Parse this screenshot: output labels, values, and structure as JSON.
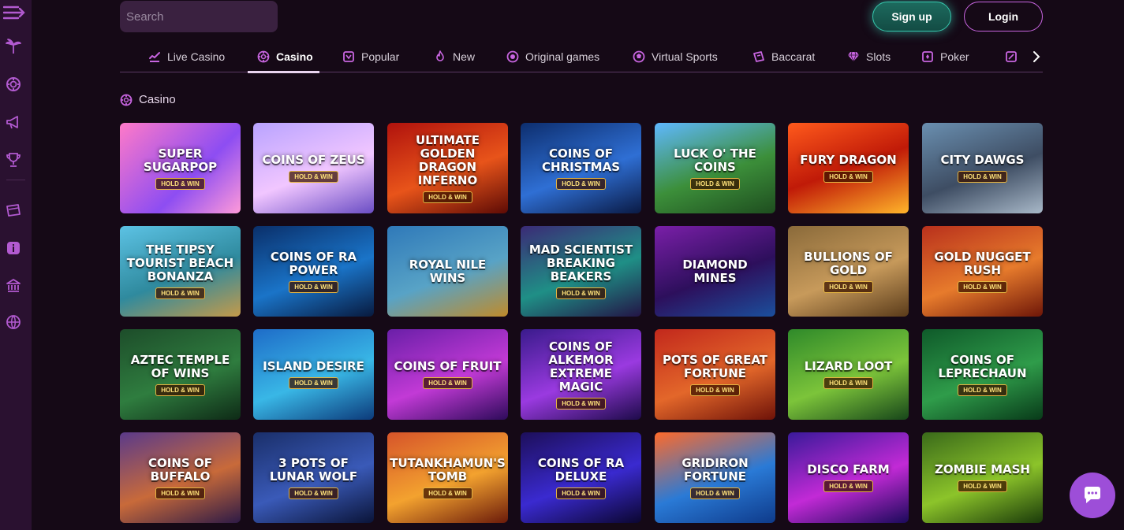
{
  "search": {
    "placeholder": "Search",
    "value": ""
  },
  "header": {
    "signup_label": "Sign up",
    "login_label": "Login"
  },
  "sidebar": {
    "icons": [
      "menu-toggle-icon",
      "palm-tree-icon",
      "casino-chip-icon",
      "megaphone-icon",
      "trophy-icon",
      "ticket-icon",
      "info-icon",
      "bank-icon",
      "globe-icon"
    ]
  },
  "tabs": [
    {
      "label": "Live Casino",
      "icon": "live-casino-icon",
      "active": false
    },
    {
      "label": "Casino",
      "icon": "casino-chip-icon",
      "active": true
    },
    {
      "label": "Popular",
      "icon": "popular-icon",
      "active": false
    },
    {
      "label": "New",
      "icon": "flame-icon",
      "active": false
    },
    {
      "label": "Original games",
      "icon": "original-games-icon",
      "active": false
    },
    {
      "label": "Virtual Sports",
      "icon": "virtual-sports-icon",
      "active": false
    },
    {
      "label": "Baccarat",
      "icon": "baccarat-icon",
      "active": false
    },
    {
      "label": "Slots",
      "icon": "diamond-icon",
      "active": false
    },
    {
      "label": "Poker",
      "icon": "poker-icon",
      "active": false
    }
  ],
  "section": {
    "title": "Casino"
  },
  "colors": {
    "accent": "#c865e0",
    "signup": "#36c8ad",
    "sidebar": "#2a1130",
    "background": "#150916",
    "chat": "#9d4ed8"
  },
  "games": [
    {
      "name": "Super SugarPop",
      "badge": "HOLD & WIN"
    },
    {
      "name": "Coins of Zeus",
      "badge": "HOLD & WIN"
    },
    {
      "name": "Ultimate Golden Dragon Inferno",
      "badge": "HOLD & WIN"
    },
    {
      "name": "Coins of Christmas",
      "badge": "HOLD & WIN"
    },
    {
      "name": "Luck o' the Coins",
      "badge": "HOLD & WIN"
    },
    {
      "name": "Fury Dragon",
      "badge": "HOLD & WIN"
    },
    {
      "name": "City Dawgs",
      "badge": "HOLD & WIN"
    },
    {
      "name": "The Tipsy Tourist Beach Bonanza",
      "badge": "HOLD & WIN"
    },
    {
      "name": "Coins of Ra Power",
      "badge": "HOLD & WIN"
    },
    {
      "name": "Royal Nile Wins",
      "badge": ""
    },
    {
      "name": "Mad Scientist Breaking Beakers",
      "badge": "HOLD & WIN"
    },
    {
      "name": "Diamond Mines",
      "badge": ""
    },
    {
      "name": "Bullions of Gold",
      "badge": "HOLD & WIN"
    },
    {
      "name": "Gold Nugget Rush",
      "badge": "HOLD & WIN"
    },
    {
      "name": "Aztec Temple of Wins",
      "badge": "HOLD & WIN"
    },
    {
      "name": "Island Desire",
      "badge": "HOLD & WIN"
    },
    {
      "name": "Coins of Fruit",
      "badge": "HOLD & WIN"
    },
    {
      "name": "Coins of Alkemor Extreme Magic",
      "badge": "HOLD & WIN"
    },
    {
      "name": "Pots of Great Fortune",
      "badge": "HOLD & WIN"
    },
    {
      "name": "Lizard Loot",
      "badge": "HOLD & WIN"
    },
    {
      "name": "Coins of Leprechaun",
      "badge": "HOLD & WIN"
    },
    {
      "name": "Coins of Buffalo",
      "badge": "HOLD & WIN"
    },
    {
      "name": "3 Pots of Lunar Wolf",
      "badge": "HOLD & WIN"
    },
    {
      "name": "Tutankhamun's Tomb",
      "badge": "HOLD & WIN"
    },
    {
      "name": "Coins of Ra Deluxe",
      "badge": "HOLD & WIN"
    },
    {
      "name": "Gridiron Fortune",
      "badge": "HOLD & WIN"
    },
    {
      "name": "Disco Farm",
      "badge": "HOLD & WIN"
    },
    {
      "name": "Zombie Mash",
      "badge": "HOLD & WIN"
    }
  ]
}
